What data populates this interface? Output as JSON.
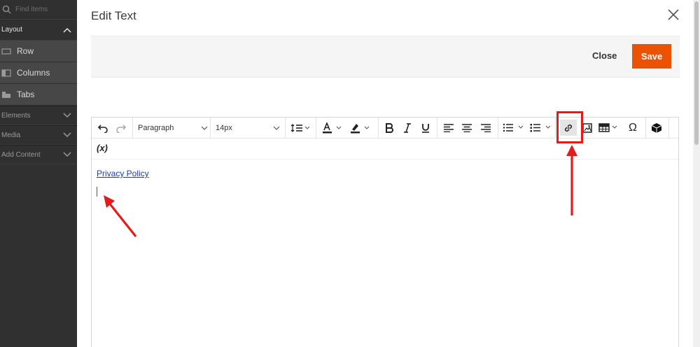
{
  "sidebar": {
    "search_placeholder": "Find items",
    "layout_label": "Layout",
    "layout_items": [
      {
        "label": "Row",
        "icon": "row-icon"
      },
      {
        "label": "Columns",
        "icon": "columns-icon"
      },
      {
        "label": "Tabs",
        "icon": "tabs-icon"
      }
    ],
    "sections": [
      {
        "label": "Elements"
      },
      {
        "label": "Media"
      },
      {
        "label": "Add Content"
      }
    ]
  },
  "modal": {
    "title": "Edit Text",
    "close_label": "Close",
    "save_label": "Save"
  },
  "toolbar": {
    "block_format": "Paragraph",
    "font_size": "14px",
    "buttons": [
      "undo-icon",
      "redo-icon",
      "line-height-icon",
      "text-color-icon",
      "highlight-color-icon",
      "bold-icon",
      "italic-icon",
      "underline-icon",
      "align-left-icon",
      "align-center-icon",
      "align-right-icon",
      "numbered-list-icon",
      "bullet-list-icon",
      "link-icon",
      "image-icon",
      "table-icon",
      "special-character-icon",
      "widget-icon"
    ],
    "special_char_glyph": "Ω"
  },
  "editor": {
    "variable_label": "(x)",
    "link_text": "Privacy Policy"
  },
  "colors": {
    "accent": "#eb5202",
    "sidebar_bg": "#303030",
    "highlight": "#e31b1b",
    "link": "#1a3fa8"
  }
}
